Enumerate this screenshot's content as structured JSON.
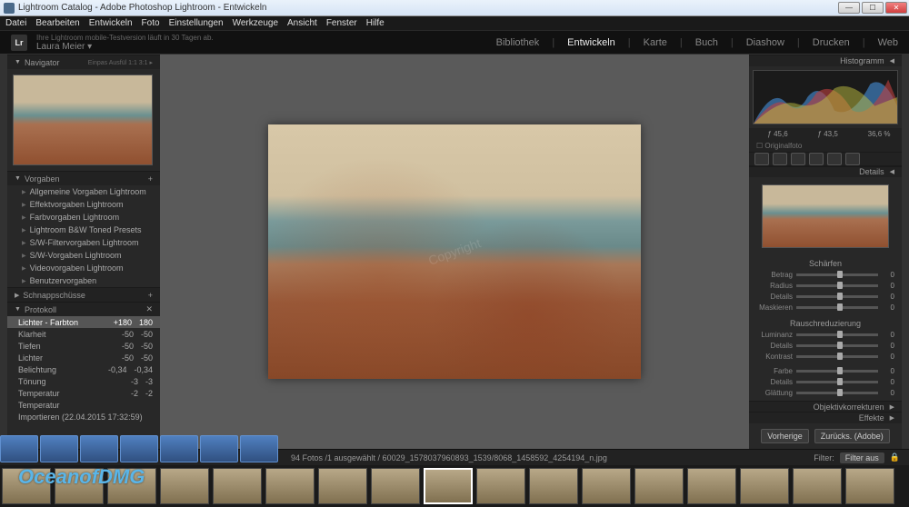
{
  "title": "Lightroom Catalog - Adobe Photoshop Lightroom - Entwickeln",
  "menu": [
    "Datei",
    "Bearbeiten",
    "Entwickeln",
    "Foto",
    "Einstellungen",
    "Werkzeuge",
    "Ansicht",
    "Fenster",
    "Hilfe"
  ],
  "trial_msg": "Ihre Lightroom mobile-Testversion läuft in 30 Tagen ab.",
  "username": "Laura Meier ▾",
  "modules": [
    "Bibliothek",
    "Entwickeln",
    "Karte",
    "Buch",
    "Diashow",
    "Drucken",
    "Web"
  ],
  "module_selected": "Entwickeln",
  "left": {
    "navigator": {
      "title": "Navigator",
      "modes": "Einpas   Ausfül   1:1   3:1 ▸"
    },
    "presets": {
      "title": "Vorgaben",
      "items": [
        "Allgemeine Vorgaben Lightroom",
        "Effektvorgaben Lightroom",
        "Farbvorgaben Lightroom",
        "Lightroom B&W Toned Presets",
        "S/W-Filtervorgaben Lightroom",
        "S/W-Vorgaben Lightroom",
        "Videovorgaben Lightroom",
        "Benutzervorgaben"
      ]
    },
    "snapshots": {
      "title": "Schnappschüsse"
    },
    "history": {
      "title": "Protokoll",
      "items": [
        {
          "label": "Lichter - Farbton",
          "v1": "+180",
          "v2": "180",
          "sel": true
        },
        {
          "label": "Klarheit",
          "v1": "-50",
          "v2": "-50"
        },
        {
          "label": "Tiefen",
          "v1": "-50",
          "v2": "-50"
        },
        {
          "label": "Lichter",
          "v1": "-50",
          "v2": "-50"
        },
        {
          "label": "Belichtung",
          "v1": "-0,34",
          "v2": "-0,34"
        },
        {
          "label": "Tönung",
          "v1": "-3",
          "v2": "-3"
        },
        {
          "label": "Temperatur",
          "v1": "-2",
          "v2": "-2"
        },
        {
          "label": "Temperatur",
          "v1": "",
          "v2": ""
        },
        {
          "label": "Importieren (22.04.2015 17:32:59)",
          "v1": "",
          "v2": ""
        }
      ]
    }
  },
  "right": {
    "histogram": {
      "title": "Histogramm",
      "values": [
        "ƒ 45,6",
        "ƒ 43,5",
        "36,6 %"
      ],
      "original": "☐ Originalfoto"
    },
    "details_title": "Details",
    "sharpen": {
      "title": "Schärfen",
      "rows": [
        {
          "l": "Betrag",
          "v": "0"
        },
        {
          "l": "Radius",
          "v": "0"
        },
        {
          "l": "Details",
          "v": "0"
        },
        {
          "l": "Maskieren",
          "v": "0"
        }
      ]
    },
    "noise": {
      "title": "Rauschreduzierung",
      "rows": [
        {
          "l": "Luminanz",
          "v": "0"
        },
        {
          "l": "Details",
          "v": "0"
        },
        {
          "l": "Kontrast",
          "v": "0"
        }
      ],
      "rows2": [
        {
          "l": "Farbe",
          "v": "0"
        },
        {
          "l": "Details",
          "v": "0"
        },
        {
          "l": "Glättung",
          "v": "0"
        }
      ]
    },
    "lens": {
      "title": "Objektivkorrekturen"
    },
    "effects": {
      "title": "Effekte"
    },
    "buttons": {
      "prev": "Vorherige",
      "reset": "Zurücks. (Adobe)"
    }
  },
  "toolbar": {
    "path": "94 Fotos /1 ausgewählt / 60029_1578037960893_1539/8068_1458592_4254194_n.jpg",
    "filter_label": "Filter:",
    "filter_off": "Filter aus"
  },
  "watermark": "OceanofDMG"
}
